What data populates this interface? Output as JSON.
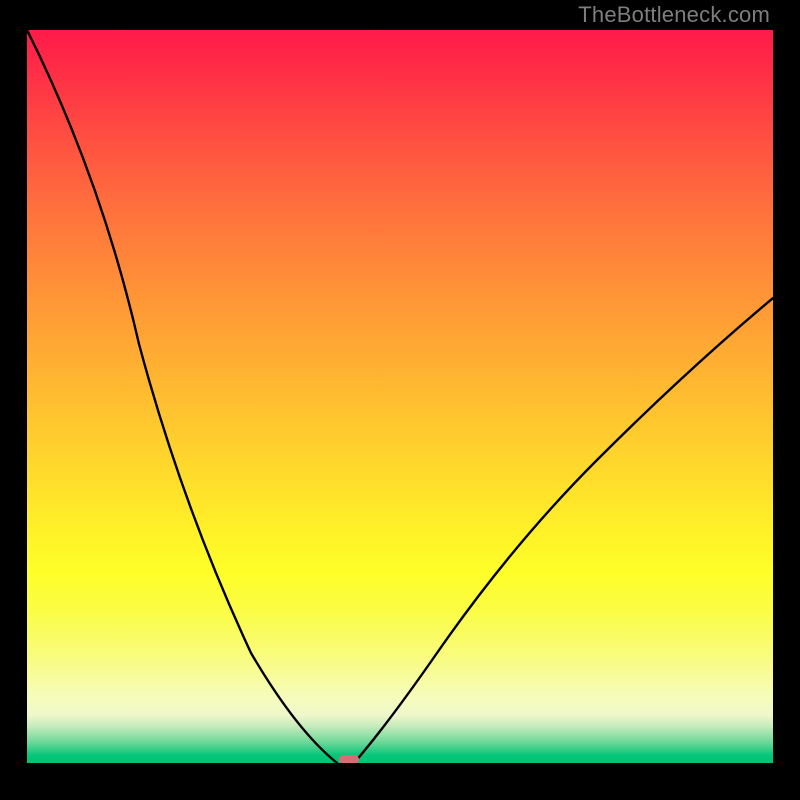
{
  "watermark": {
    "text": "TheBottleneck.com"
  },
  "chart_data": {
    "type": "line",
    "title": "",
    "xlabel": "",
    "ylabel": "",
    "xlim": [
      0,
      1
    ],
    "ylim": [
      0,
      100
    ],
    "background_gradient": {
      "direction": "vertical",
      "stops": [
        {
          "at": 0,
          "color": "#fe1b4a",
          "meaning": "100% bottleneck"
        },
        {
          "at": 50,
          "color": "#ffd72c",
          "meaning": "moderate"
        },
        {
          "at": 100,
          "color": "#00c374",
          "meaning": "0% bottleneck"
        }
      ]
    },
    "series": [
      {
        "name": "bottleneck-curve-left",
        "x": [
          0.0,
          0.05,
          0.1,
          0.15,
          0.2,
          0.25,
          0.3,
          0.35,
          0.38,
          0.4,
          0.415
        ],
        "values": [
          100.0,
          85.0,
          71.0,
          57.5,
          44.5,
          32.0,
          21.0,
          11.0,
          5.5,
          2.0,
          0.0
        ]
      },
      {
        "name": "bottleneck-curve-right",
        "x": [
          0.44,
          0.47,
          0.52,
          0.58,
          0.65,
          0.73,
          0.82,
          0.91,
          1.0
        ],
        "values": [
          0.0,
          4.0,
          11.0,
          19.0,
          28.5,
          38.0,
          47.0,
          55.5,
          63.5
        ]
      }
    ],
    "marker": {
      "x": 0.426,
      "y": 0.0,
      "color": "#d96d77"
    }
  }
}
